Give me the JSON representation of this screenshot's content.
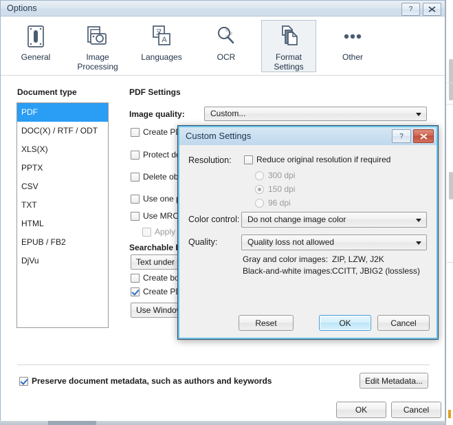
{
  "window": {
    "title": "Options",
    "help_button": "?",
    "close_button": "✕"
  },
  "toolbar": {
    "items": [
      {
        "label": "General",
        "icon": "device-icon",
        "selected": false
      },
      {
        "label": "Image\nProcessing",
        "label_line1": "Image",
        "label_line2": "Processing",
        "icon": "camera-photo-icon",
        "selected": false
      },
      {
        "label": "Languages",
        "icon": "language-translate-icon",
        "selected": false
      },
      {
        "label": "OCR",
        "icon": "magnifier-icon",
        "selected": false
      },
      {
        "label": "Format Settings",
        "label_line1": "Format",
        "label_line2": "Settings",
        "icon": "documents-stack-icon",
        "selected": true
      },
      {
        "label": "Other",
        "icon": "ellipsis-icon",
        "selected": false
      }
    ]
  },
  "document_type": {
    "heading": "Document type",
    "items": [
      "PDF",
      "DOC(X) / RTF / ODT",
      "XLS(X)",
      "PPTX",
      "CSV",
      "TXT",
      "HTML",
      "EPUB / FB2",
      "DjVu"
    ],
    "selected": "PDF"
  },
  "pdf_settings": {
    "heading": "PDF Settings",
    "image_quality_label": "Image quality:",
    "image_quality_value": "Custom...",
    "checkboxes": [
      {
        "label": "Create PDF",
        "checked": false
      },
      {
        "label": "Protect doc",
        "checked": false
      },
      {
        "label": "Delete obje",
        "checked": false
      },
      {
        "label": "Use one pa",
        "checked": false
      },
      {
        "label": "Use MRC co",
        "checked": false
      },
      {
        "label": "Apply AB",
        "checked": false,
        "disabled": true,
        "indented": true
      }
    ],
    "searchable_heading": "Searchable P",
    "text_under_combo": "Text under th",
    "bottom_checkboxes": [
      {
        "label": "Create bool",
        "checked": false
      },
      {
        "label": "Create PDF",
        "checked": true
      }
    ],
    "use_windows_button": "Use Windows"
  },
  "dialog": {
    "title": "Custom Settings",
    "help_button": "?",
    "close_button": "✕",
    "resolution_label": "Resolution:",
    "reduce_checkbox_label": "Reduce original resolution if required",
    "reduce_checkbox_checked": false,
    "dpi_options": [
      {
        "label": "300 dpi",
        "selected": false
      },
      {
        "label": "150 dpi",
        "selected": true
      },
      {
        "label": "96 dpi",
        "selected": false
      }
    ],
    "color_control_label": "Color control:",
    "color_control_value": "Do not change image color",
    "quality_label": "Quality:",
    "quality_value": "Quality loss not allowed",
    "info_rows": [
      {
        "name": "Gray and color images:",
        "value": "ZIP, LZW, J2K"
      },
      {
        "name": "Black-and-white images:",
        "value": "CCITT, JBIG2 (lossless)"
      }
    ],
    "reset_button": "Reset",
    "ok_button": "OK",
    "cancel_button": "Cancel"
  },
  "footer": {
    "preserve_metadata_label": "Preserve document metadata, such as authors and keywords",
    "preserve_metadata_checked": true,
    "edit_metadata_button": "Edit Metadata...",
    "ok_button": "OK",
    "cancel_button": "Cancel"
  },
  "colors": {
    "selection_blue": "#2a9df4",
    "dialog_accent": "#6cc2e8",
    "close_red": "#c0503c",
    "icon_stroke": "#4a5c70"
  }
}
